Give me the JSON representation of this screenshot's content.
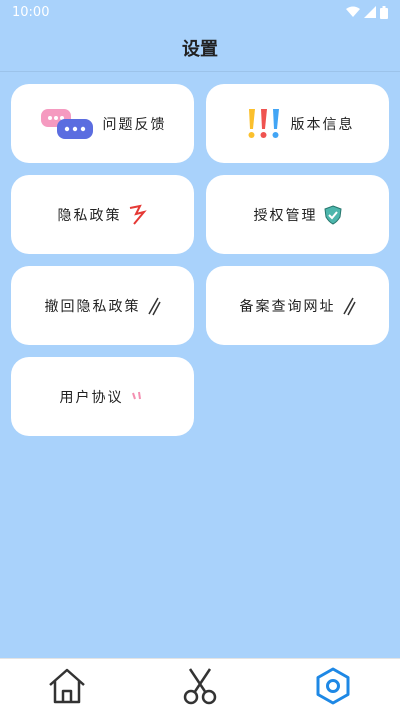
{
  "status_bar": {
    "time": "10:00"
  },
  "header": {
    "title": "设置"
  },
  "cards": [
    {
      "label": "问题反馈",
      "icon": "chat-bubbles-icon"
    },
    {
      "label": "版本信息",
      "icon": "exclamation-marks-icon"
    },
    {
      "label": "隐私政策",
      "icon": "sticker-icon"
    },
    {
      "label": "授权管理",
      "icon": "shield-icon"
    },
    {
      "label": "撤回隐私政策",
      "icon": "pencil-icon"
    },
    {
      "label": "备案查询网址",
      "icon": "pencil-icon"
    },
    {
      "label": "用户协议",
      "icon": "sticker-icon"
    }
  ],
  "bottom_nav": [
    {
      "name": "home",
      "icon": "home-icon",
      "active": false
    },
    {
      "name": "scissors",
      "icon": "scissors-icon",
      "active": false
    },
    {
      "name": "settings",
      "icon": "settings-hexagon-icon",
      "active": true
    }
  ],
  "colors": {
    "background": "#a9d2fb",
    "accent": "#1e88e5",
    "card": "#ffffff"
  }
}
